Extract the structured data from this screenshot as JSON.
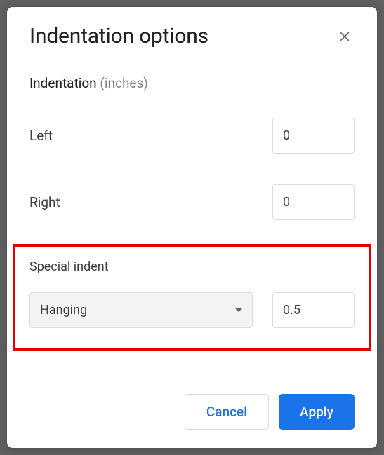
{
  "dialog": {
    "title": "Indentation options",
    "section_label": "Indentation",
    "section_unit": "(inches)",
    "left": {
      "label": "Left",
      "value": "0"
    },
    "right": {
      "label": "Right",
      "value": "0"
    },
    "special": {
      "label": "Special indent",
      "selected": "Hanging",
      "value": "0.5"
    },
    "actions": {
      "cancel": "Cancel",
      "apply": "Apply"
    }
  }
}
